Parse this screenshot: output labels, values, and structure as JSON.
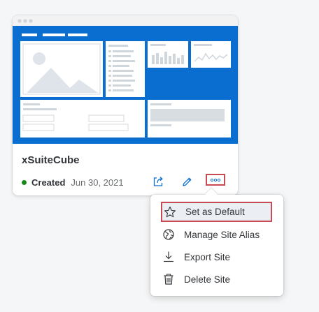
{
  "site_card": {
    "title": "xSuiteCube",
    "status": "Created",
    "date": "Jun 30, 2021",
    "status_color": "#188918",
    "accent_color": "#0a6ed1",
    "actions": [
      {
        "name": "share",
        "icon": "share-icon"
      },
      {
        "name": "edit",
        "icon": "pencil-icon"
      },
      {
        "name": "more",
        "icon": "overflow-icon"
      }
    ]
  },
  "menu": {
    "items": [
      {
        "label": "Set as Default",
        "icon": "star-icon",
        "focused": true
      },
      {
        "label": "Manage Site Alias",
        "icon": "globe-icon",
        "focused": false
      },
      {
        "label": "Export Site",
        "icon": "download-icon",
        "focused": false
      },
      {
        "label": "Delete Site",
        "icon": "trash-icon",
        "focused": false
      }
    ]
  }
}
